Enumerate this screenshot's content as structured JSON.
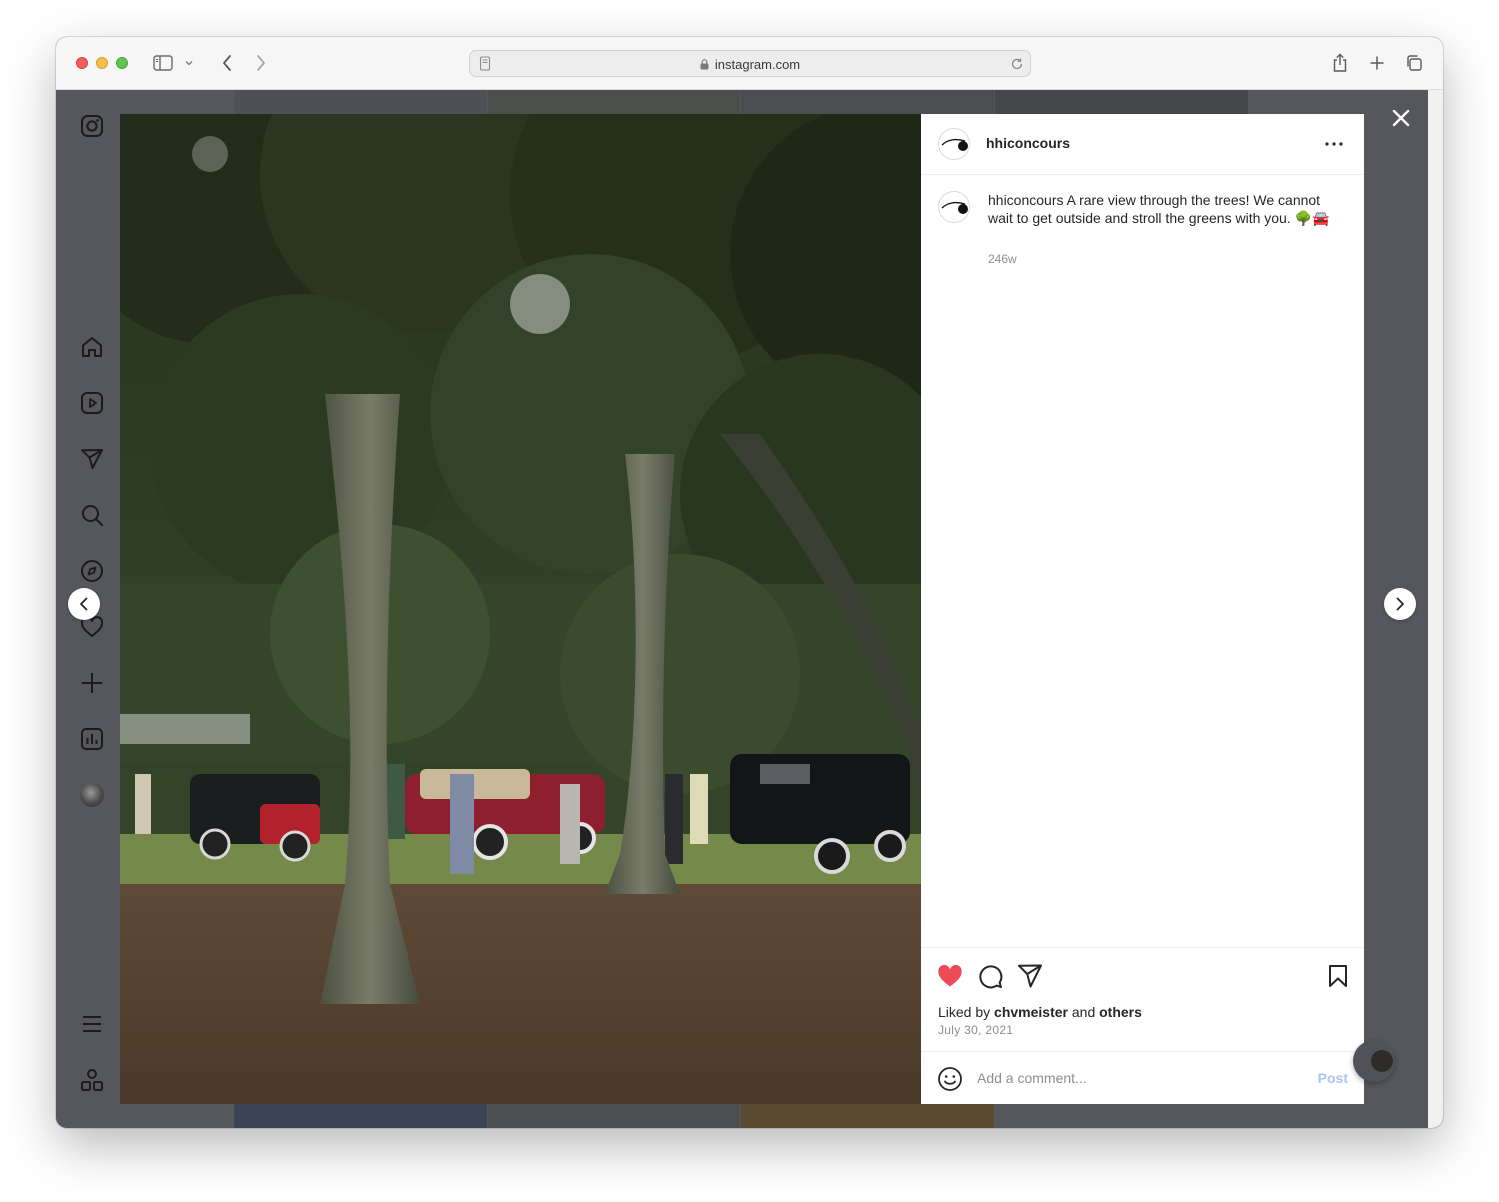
{
  "browser": {
    "url": "instagram.com"
  },
  "post": {
    "username": "hhiconcours",
    "caption_user": "hhiconcours",
    "caption_text": "A rare view through the trees! We cannot wait to get outside and stroll the greens with you. 🌳🚘",
    "time_ago": "246w",
    "liked_by_prefix": "Liked by ",
    "liked_by_user": "chvmeister",
    "liked_by_and": " and ",
    "liked_by_others": "others",
    "date": "July 30, 2021",
    "comment_placeholder": "Add a comment...",
    "post_label": "Post"
  },
  "colors": {
    "like_red": "#ed4956",
    "post_blue": "#a8c6ee"
  },
  "sidebar": {
    "items": [
      "instagram-logo-icon",
      "home-icon",
      "reels-icon",
      "direct-icon",
      "search-icon",
      "explore-icon",
      "heart-icon",
      "create-icon",
      "dashboard-icon",
      "profile-avatar",
      "menu-icon",
      "more-apps-icon"
    ]
  }
}
